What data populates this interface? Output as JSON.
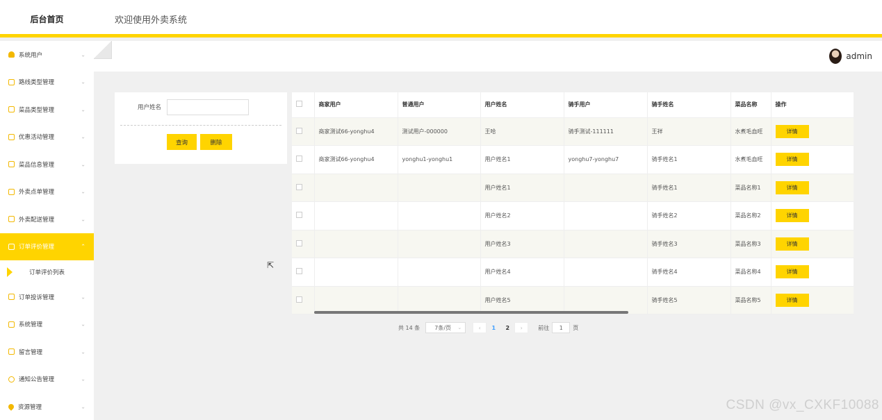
{
  "topbar": {
    "logo": "后台首页",
    "welcome": "欢迎使用外卖系统"
  },
  "user": {
    "name": "admin"
  },
  "sidebar": {
    "items": [
      {
        "label": "系统用户",
        "icon": "user-icon"
      },
      {
        "label": "路线类型管理",
        "icon": "square-icon"
      },
      {
        "label": "菜品类型管理",
        "icon": "square-icon"
      },
      {
        "label": "优惠活动管理",
        "icon": "square-icon"
      },
      {
        "label": "菜品信息管理",
        "icon": "square-icon"
      },
      {
        "label": "外卖点单管理",
        "icon": "square-icon"
      },
      {
        "label": "外卖配送管理",
        "icon": "square-icon"
      },
      {
        "label": "订单评价管理",
        "icon": "square-icon",
        "active": true
      },
      {
        "label": "订单投诉管理",
        "icon": "square-icon"
      },
      {
        "label": "系统管理",
        "icon": "image-icon"
      },
      {
        "label": "留言管理",
        "icon": "image-icon"
      },
      {
        "label": "通知公告管理",
        "icon": "info-icon"
      },
      {
        "label": "资源管理",
        "icon": "pin-icon"
      }
    ],
    "submenu": {
      "label": "订单评价列表"
    }
  },
  "search": {
    "label": "用户姓名",
    "value": "",
    "query_label": "查询",
    "delete_label": "删除"
  },
  "table": {
    "headers": [
      "商家用户",
      "普通用户",
      "用户姓名",
      "骑手用户",
      "骑手姓名",
      "菜品名称",
      "操作"
    ],
    "detail_label": "详情",
    "rows": [
      [
        "商家测试66-yonghu4",
        "测试用户-000000",
        "王哈",
        "骑手测试-111111",
        "王祥",
        "水煮毛血旺"
      ],
      [
        "商家测试66-yonghu4",
        "yonghu1-yonghu1",
        "用户姓名1",
        "yonghu7-yonghu7",
        "骑手姓名1",
        "水煮毛血旺"
      ],
      [
        "",
        "",
        "用户姓名1",
        "",
        "骑手姓名1",
        "菜品名称1"
      ],
      [
        "",
        "",
        "用户姓名2",
        "",
        "骑手姓名2",
        "菜品名称2"
      ],
      [
        "",
        "",
        "用户姓名3",
        "",
        "骑手姓名3",
        "菜品名称3"
      ],
      [
        "",
        "",
        "用户姓名4",
        "",
        "骑手姓名4",
        "菜品名称4"
      ],
      [
        "",
        "",
        "用户姓名5",
        "",
        "骑手姓名5",
        "菜品名称5"
      ]
    ]
  },
  "pager": {
    "total": "共 14 条",
    "page_size": "7条/页",
    "pages": [
      "1",
      "2"
    ],
    "current": "1",
    "goto_label": "前往",
    "goto_value": "1",
    "page_unit": "页",
    "prev": "‹",
    "next": "›"
  },
  "watermark": "CSDN @vx_CXKF10088",
  "colors": {
    "accent": "#FFD400",
    "page_bg": "#f0f0f0"
  }
}
